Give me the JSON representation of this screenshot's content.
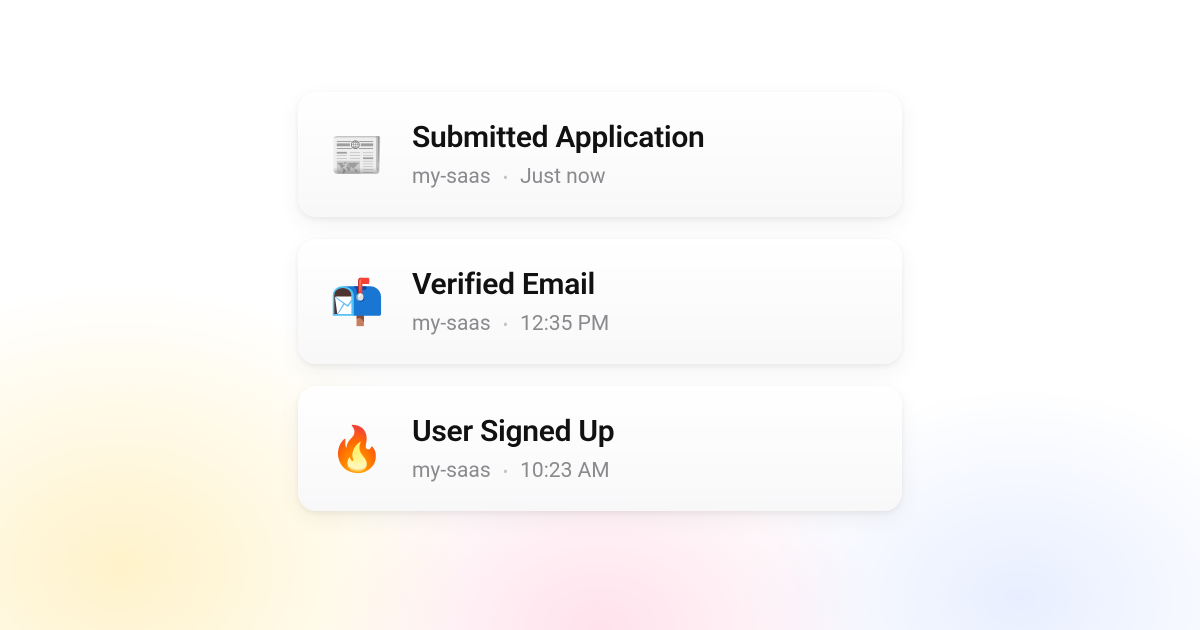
{
  "notifications": [
    {
      "icon": "📰",
      "icon_name": "newspaper-icon",
      "title": "Submitted Application",
      "project": "my-saas",
      "time": "Just now"
    },
    {
      "icon": "📬",
      "icon_name": "mailbox-icon",
      "title": "Verified Email",
      "project": "my-saas",
      "time": "12:35 PM"
    },
    {
      "icon": "🔥",
      "icon_name": "fire-icon",
      "title": "User Signed Up",
      "project": "my-saas",
      "time": "10:23 AM"
    }
  ]
}
